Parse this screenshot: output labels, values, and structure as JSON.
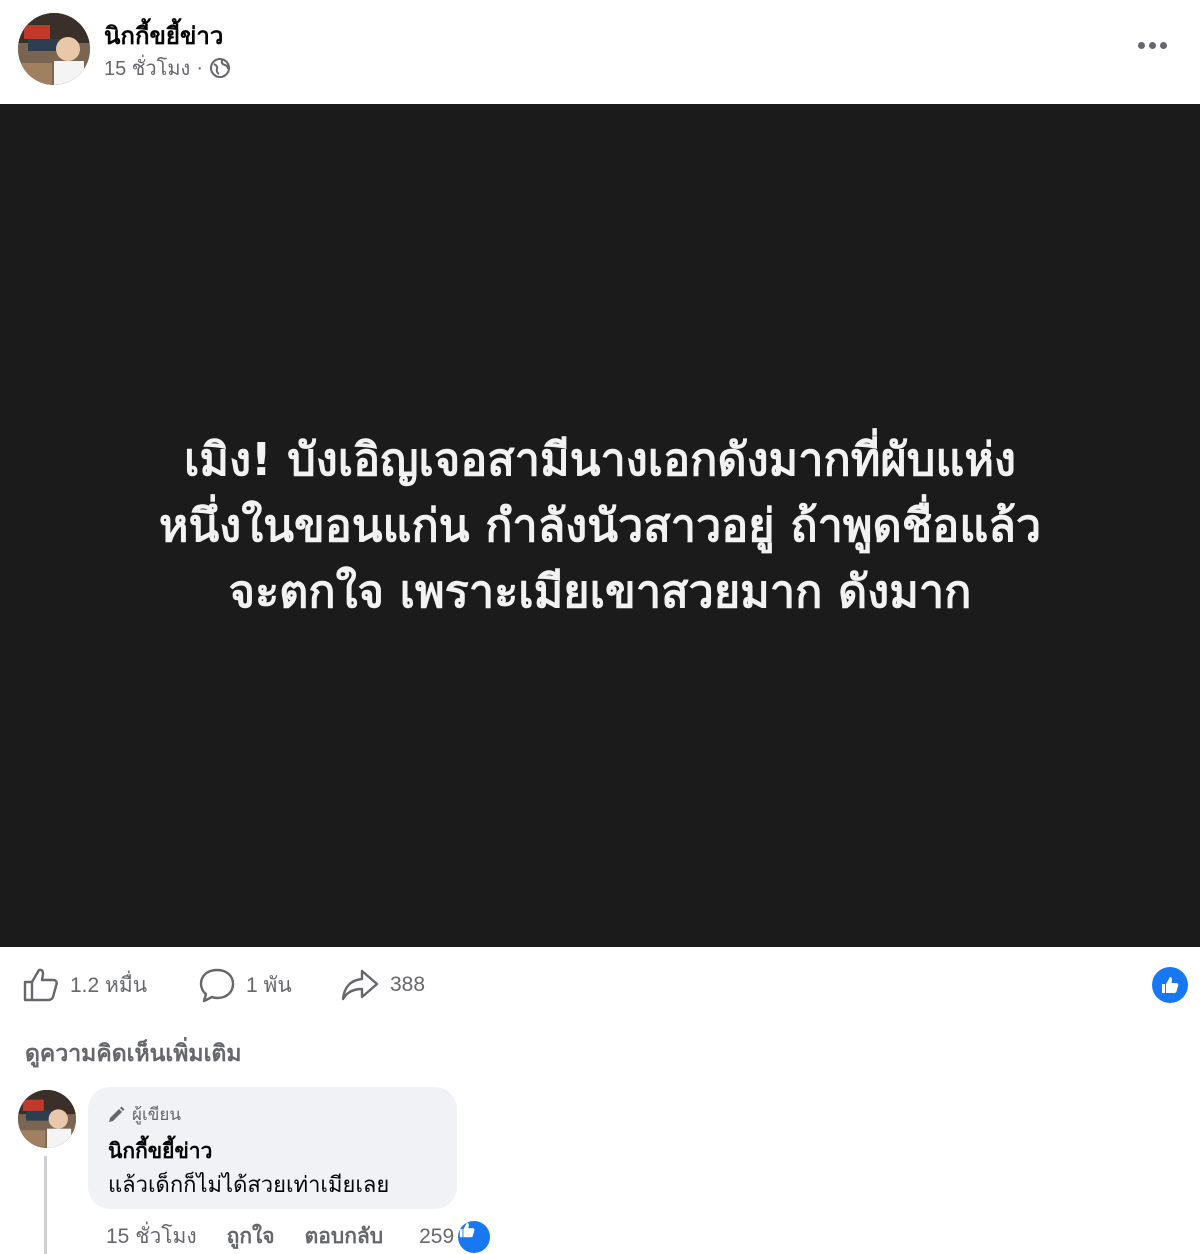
{
  "post": {
    "author": "นิกกี้ขยี้ข่าว",
    "time": "15 ชั่วโมง",
    "separator": "·",
    "privacy_icon": "globe-icon",
    "image_text_lines": [
      "เมิง! บังเอิญเจอสามีนางเอกดังมากที่ผับแห่ง",
      "หนึ่งในขอนแก่น กำลังนัวสาวอยู่ ถ้าพูดชื่อแล้ว",
      "จะตกใจ เพราะเมียเขาสวยมาก ดังมาก"
    ]
  },
  "actions": {
    "likes": "1.2 หมื่น",
    "comments": "1 พัน",
    "shares": "388"
  },
  "more_comments_label": "ดูความคิดเห็นเพิ่มเติม",
  "comment": {
    "badge": "ผู้เขียน",
    "author": "นิกกี้ขยี้ข่าว",
    "text": "แล้วเด็กก็ไม่ได้สวยเท่าเมียเลย",
    "time": "15 ชั่วโมง",
    "like_label": "ถูกใจ",
    "reply_label": "ตอบกลับ",
    "reactions": "259"
  },
  "colors": {
    "image_background": "#1b1b1b",
    "like_blue": "#1877f2",
    "secondary_text": "#65676b"
  }
}
